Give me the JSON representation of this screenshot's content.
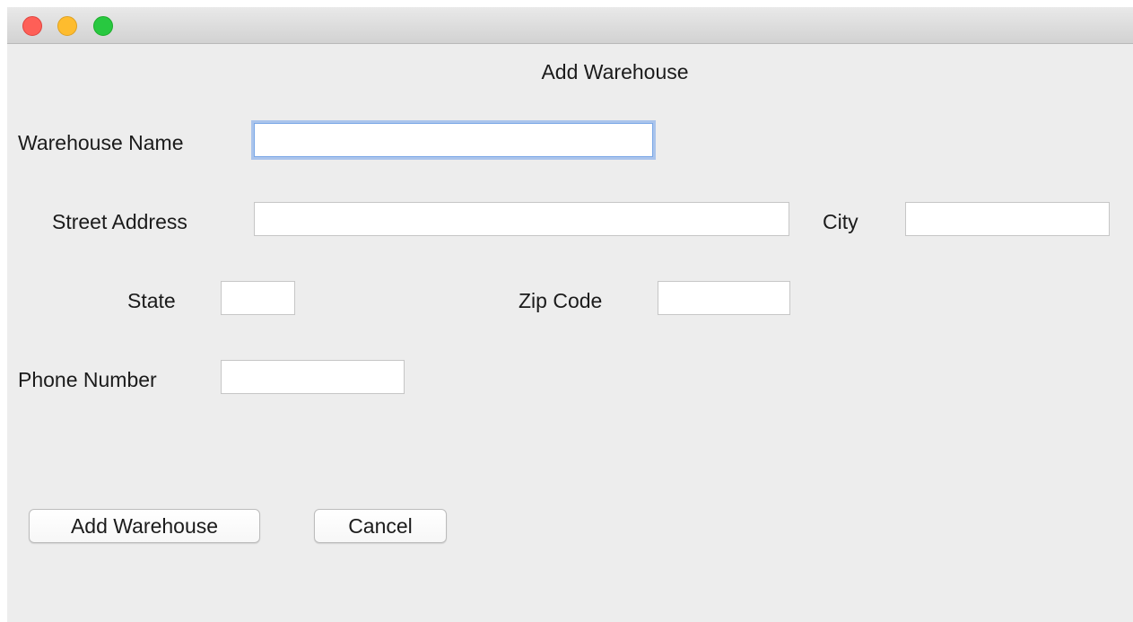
{
  "window": {
    "controls": {
      "close": "close-traffic-light",
      "minimize": "minimize-traffic-light",
      "zoom": "zoom-traffic-light"
    }
  },
  "form": {
    "title": "Add Warehouse",
    "fields": {
      "warehouse_name": {
        "label": "Warehouse Name",
        "value": ""
      },
      "street_address": {
        "label": "Street Address",
        "value": ""
      },
      "city": {
        "label": "City",
        "value": ""
      },
      "state": {
        "label": "State",
        "value": ""
      },
      "zip_code": {
        "label": "Zip Code",
        "value": ""
      },
      "phone_number": {
        "label": "Phone Number",
        "value": ""
      }
    },
    "buttons": {
      "add_label": "Add Warehouse",
      "cancel_label": "Cancel"
    }
  },
  "colors": {
    "close": "#fe5f57",
    "minimize": "#febc2e",
    "zoom": "#28c840",
    "focus_ring": "#7aa7e6",
    "window_bg": "#ededed"
  }
}
